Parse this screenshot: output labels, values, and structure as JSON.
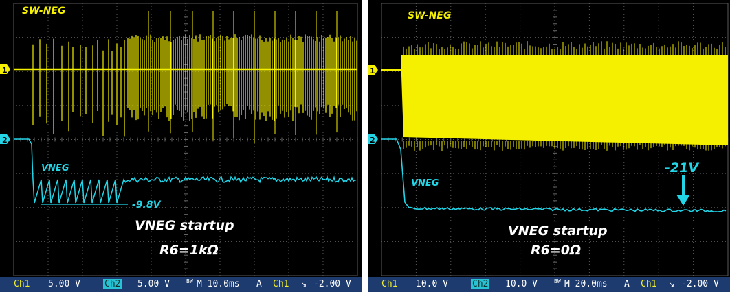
{
  "chart_data": [
    {
      "type": "line",
      "traces": [
        {
          "channel": "1",
          "name": "SW-NEG",
          "color": "#f4f000"
        },
        {
          "channel": "2",
          "name": "VNEG",
          "color": "#22d6e8"
        }
      ],
      "annotations": [
        "-9.8V"
      ],
      "caption_line1": "VNEG startup",
      "caption_line2": "R6=1kΩ",
      "status": {
        "ch1_label": "Ch1",
        "ch1_scale": "5.00 V",
        "ch2_label": "Ch2",
        "ch2_scale": "5.00 V",
        "bw": "BW",
        "timebase": "M 10.0ms",
        "mode": "A",
        "trig_src": "Ch1",
        "trig_slope": "↘",
        "trig_level": "-2.00 V"
      }
    },
    {
      "type": "line",
      "traces": [
        {
          "channel": "1",
          "name": "SW-NEG",
          "color": "#f4f000"
        },
        {
          "channel": "2",
          "name": "VNEG",
          "color": "#22d6e8"
        }
      ],
      "annotations": [
        "-21V"
      ],
      "caption_line1": "VNEG startup",
      "caption_line2": "R6=0Ω",
      "status": {
        "ch1_label": "Ch1",
        "ch1_scale": "10.0 V",
        "ch2_label": "Ch2",
        "ch2_scale": "10.0 V",
        "bw": "BW",
        "timebase": "M 20.0ms",
        "mode": "A",
        "trig_src": "Ch1",
        "trig_slope": "↘",
        "trig_level": "-2.00 V"
      }
    }
  ]
}
